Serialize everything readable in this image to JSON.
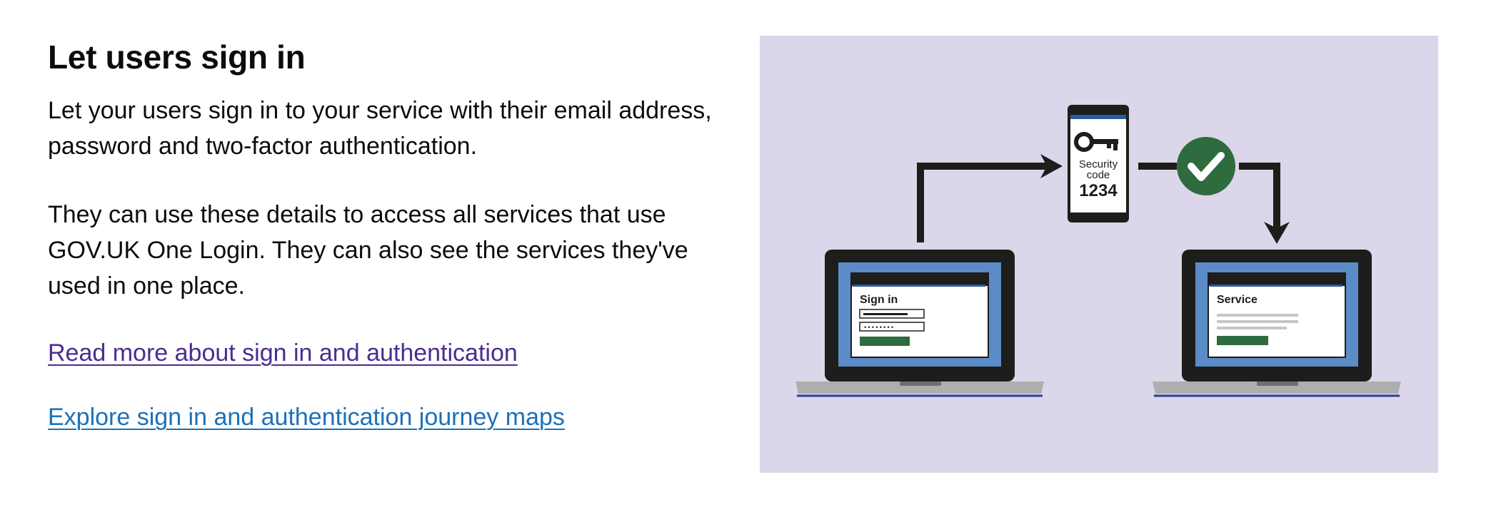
{
  "section": {
    "title": "Let users sign in",
    "paragraph1": "Let your users sign in to your service with their email address, password and two-factor authentication.",
    "paragraph2": "They can use these details to access all services that use GOV.UK One Login. They can also see the services they've used in one place.",
    "link_read_more": "Read more about sign in and authentication",
    "link_explore": "Explore sign in and authentication journey maps"
  },
  "illustration": {
    "signin_screen_label": "Sign in",
    "phone_label_line1": "Security",
    "phone_label_line2": "code",
    "phone_code": "1234",
    "service_screen_label": "Service",
    "icons": [
      "laptop-icon",
      "phone-icon",
      "key-icon",
      "check-icon",
      "arrow-icon"
    ]
  },
  "colors": {
    "link_visited": "#4c2c92",
    "link": "#1d70b8",
    "illustration_bg": "#dbd6e9",
    "screen_blue": "#5b8cc8",
    "button_green": "#2e6b3f",
    "check_green": "#2e6b3f"
  }
}
